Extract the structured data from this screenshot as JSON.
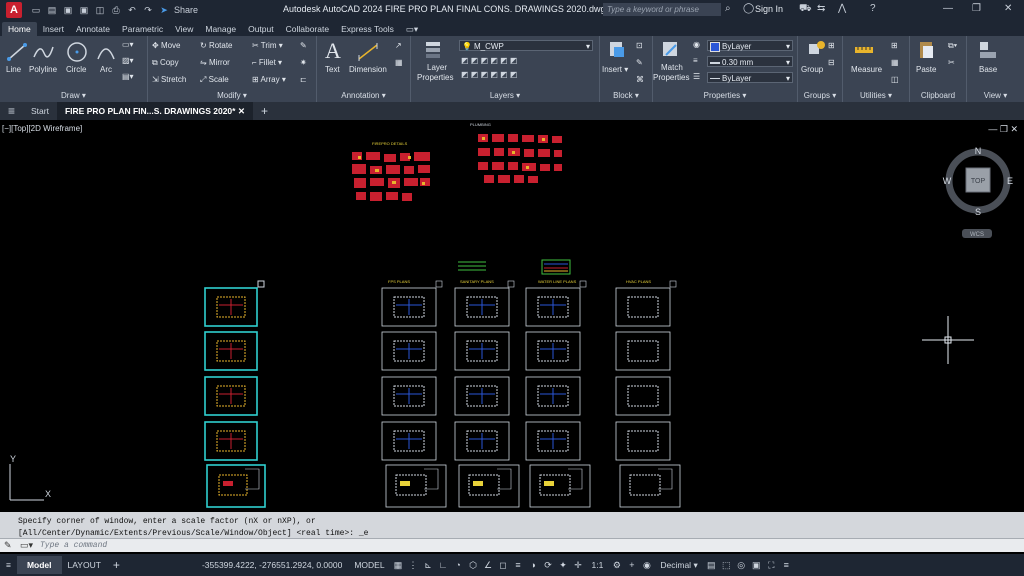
{
  "app": {
    "title": "Autodesk AutoCAD 2024   FIRE PRO PLAN FINAL CONS. DRAWINGS 2020.dwg",
    "logo_letter": "A",
    "share_label": "Share",
    "search_placeholder": "Type a keyword or phrase",
    "signin_label": "Sign In"
  },
  "ribbon_tabs": [
    "Home",
    "Insert",
    "Annotate",
    "Parametric",
    "View",
    "Manage",
    "Output",
    "Collaborate",
    "Express Tools"
  ],
  "ribbon": {
    "draw": {
      "title": "Draw",
      "line": "Line",
      "polyline": "Polyline",
      "circle": "Circle",
      "arc": "Arc"
    },
    "modify": {
      "title": "Modify",
      "move": "Move",
      "rotate": "Rotate",
      "trim": "Trim",
      "copy": "Copy",
      "mirror": "Mirror",
      "fillet": "Fillet",
      "stretch": "Stretch",
      "scale": "Scale",
      "array": "Array"
    },
    "annotation": {
      "title": "Annotation",
      "text": "Text",
      "dimension": "Dimension"
    },
    "layers": {
      "title": "Layers",
      "layer_properties_1": "Layer",
      "layer_properties_2": "Properties",
      "current_layer": "M_CWP"
    },
    "block": {
      "title": "Block",
      "insert": "Insert"
    },
    "properties": {
      "title": "Properties",
      "match_1": "Match",
      "match_2": "Properties",
      "color": "ByLayer",
      "lineweight": "0.30 mm",
      "linetype": "ByLayer"
    },
    "groups": {
      "title": "Groups",
      "group": "Group"
    },
    "utilities": {
      "title": "Utilities",
      "measure": "Measure"
    },
    "clipboard": {
      "title": "Clipboard",
      "paste": "Paste"
    },
    "view": {
      "title": "View",
      "base": "Base"
    }
  },
  "doc_tabs": {
    "start": "Start",
    "active": "FIRE PRO PLAN FIN...S. DRAWINGS 2020*"
  },
  "viewport": {
    "label": "[−][Top][2D Wireframe]",
    "compass": {
      "n": "N",
      "s": "S",
      "e": "E",
      "w": "W",
      "top": "TOP",
      "wcs": "WCS"
    },
    "ucs_y": "Y",
    "ucs_x": "X"
  },
  "drawing_titles": {
    "plumbing": "PLUMBING",
    "firepro": "FIREPRO DETAILS",
    "fps": "FPS PLANS",
    "sanitary": "SANITARY PLANS",
    "waterline": "WATER LINE PLANS",
    "hvac": "HVAC PLANS"
  },
  "command": {
    "line1": "Specify corner of window, enter a scale factor (nX or nXP), or",
    "line2": "[All/Center/Dynamic/Extents/Previous/Scale/Window/Object] <real time>: _e",
    "placeholder": "Type a command"
  },
  "status": {
    "model_tab": "Model",
    "layout_tab": "LAYOUT",
    "coords": "-355399.4222, -276551.2924, 0.0000",
    "mode": "MODEL",
    "scale": "1:1",
    "units": "Decimal"
  },
  "colors": {
    "accent": "#3a7bd5",
    "ribbon_bg": "#3b4453",
    "title_bg": "#1e2633"
  }
}
